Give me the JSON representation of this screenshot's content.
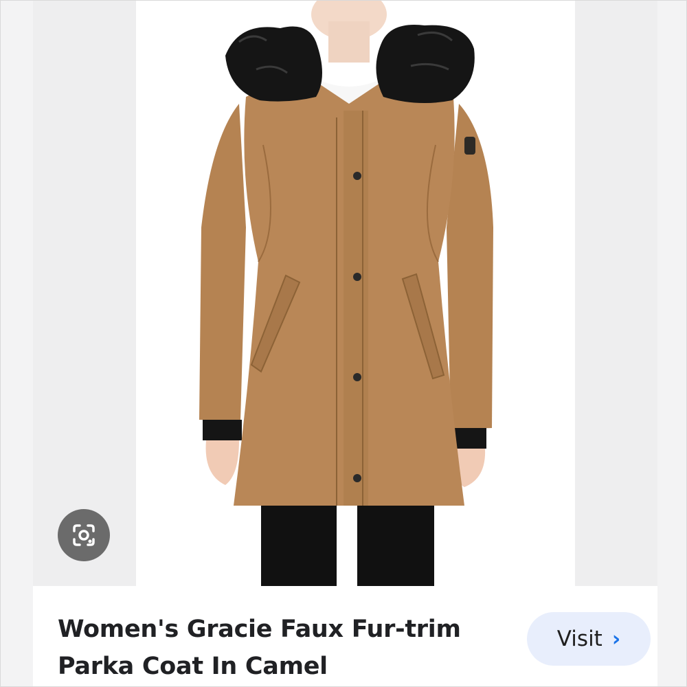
{
  "product": {
    "title_line1": "Women's Gracie Faux Fur-trim",
    "title_line2": "Parka Coat In Camel"
  },
  "actions": {
    "visit_label": "Visit",
    "visit_icon": "chevron-right-icon",
    "lens_icon": "google-lens-icon"
  },
  "colors": {
    "coat": "#b98757",
    "fur": "#151515",
    "visit_bg": "#e8eefc",
    "chevron": "#1a73e8"
  }
}
